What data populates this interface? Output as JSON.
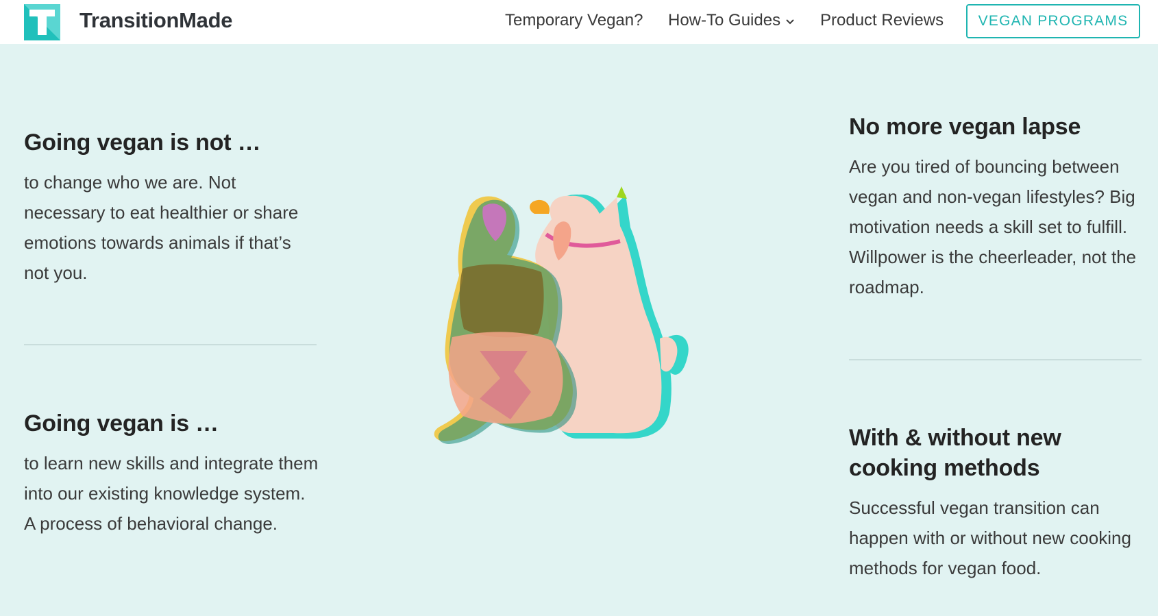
{
  "header": {
    "brand": "TransitionMade",
    "nav": {
      "temporary_vegan": "Temporary Vegan?",
      "how_to_guides": "How-To Guides",
      "product_reviews": "Product Reviews"
    },
    "cta_label": "VEGAN PROGRAMS"
  },
  "sections": {
    "left_top": {
      "title": "Going vegan is not …",
      "body": "to change who we are. Not necessary to eat healthier or share emotions towards animals if that’s not you."
    },
    "left_bottom": {
      "title": "Going vegan is …",
      "body": "to learn new skills and integrate them into our existing knowledge system. A process of behavioral change."
    },
    "right_top": {
      "title": "No more vegan lapse",
      "body": "Are you tired of bouncing between vegan and non-vegan lifestyles? Big motivation needs a skill set to fulfill. Willpower is the cheerleader, not the roadmap."
    },
    "right_bottom": {
      "title": "With & without new cooking methods",
      "body": "Successful vegan transition can happen with or without new cooking methods for vegan food."
    }
  },
  "colors": {
    "accent": "#1fb5b1",
    "background": "#e1f3f2",
    "header_bg": "#ffffff"
  },
  "icons": {
    "logo": "logo-t-icon",
    "dropdown": "chevron-down-icon"
  }
}
